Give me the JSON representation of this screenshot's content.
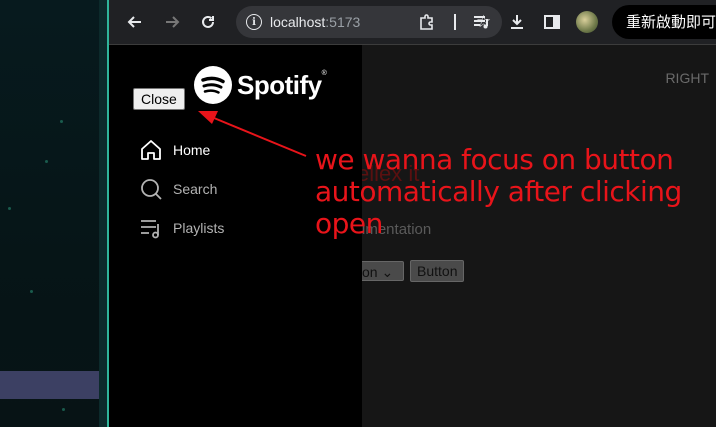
{
  "browser": {
    "url_host": "localhost",
    "url_port": ":5173",
    "relaunch_label": "重新啟動即可"
  },
  "page": {
    "logo_text": "Spotify",
    "close_button": "Close",
    "nav": [
      {
        "label": "Home",
        "icon": "home-icon",
        "active": true
      },
      {
        "label": "Search",
        "icon": "search-icon",
        "active": false
      },
      {
        "label": "Playlists",
        "icon": "playlist-icon",
        "active": false
      }
    ],
    "main": {
      "right_text": "RIGHT",
      "heading": "ellex it",
      "doc_text": "umentation",
      "select_value": "tion",
      "button_label": "Button"
    }
  },
  "annotation": {
    "text_line1": "we wanna focus on button",
    "text_line2": "automatically after clicking",
    "text_line3": "open",
    "color": "#e8141a"
  }
}
